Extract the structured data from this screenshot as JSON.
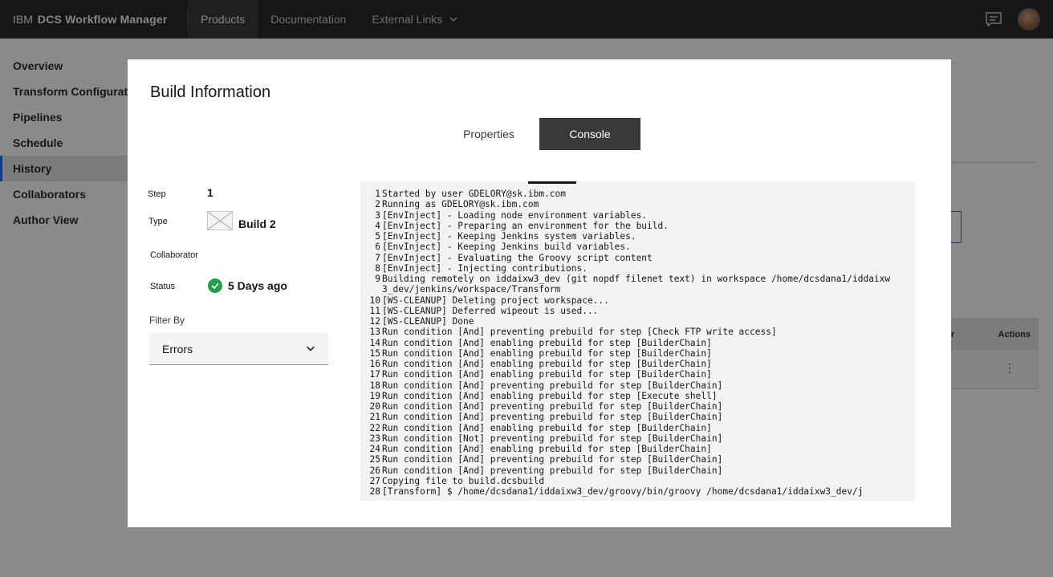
{
  "header": {
    "brand_prefix": "IBM",
    "brand_name": "DCS Workflow Manager",
    "nav": [
      {
        "label": "Products",
        "active": true
      },
      {
        "label": "Documentation",
        "active": false
      },
      {
        "label": "External Links",
        "active": false
      }
    ],
    "icons": [
      "chat-icon",
      "avatar"
    ]
  },
  "sidenav": {
    "items": [
      {
        "label": "Overview",
        "active": false
      },
      {
        "label": "Transform Configuration",
        "active": false
      },
      {
        "label": "Pipelines",
        "active": false
      },
      {
        "label": "Schedule",
        "active": false
      },
      {
        "label": "History",
        "active": true
      },
      {
        "label": "Collaborators",
        "active": false
      },
      {
        "label": "Author View",
        "active": false
      }
    ]
  },
  "background_table": {
    "col_partial": "r",
    "actions_header": "Actions",
    "row_menu_icon": "overflow-menu-icon"
  },
  "modal": {
    "title": "Build Information",
    "tabs": [
      {
        "label": "Properties",
        "selected": false
      },
      {
        "label": "Console",
        "selected": true
      }
    ],
    "details": {
      "step_label": "Step",
      "step_value": "1",
      "type_label": "Type",
      "type_value": "Build 2",
      "collaborator_label": "Collaborator",
      "collaborator_value": "",
      "status_label": "Status",
      "status_value": "5 Days ago",
      "status_icon": "checkmark-filled-icon",
      "status_color": "#24a148"
    },
    "filter": {
      "label": "Filter By",
      "selected": "Errors"
    },
    "console": [
      {
        "n": "1",
        "t": "Started by user GDELORY@sk.ibm.com"
      },
      {
        "n": "2",
        "t": "Running as GDELORY@sk.ibm.com"
      },
      {
        "n": "3",
        "t": "[EnvInject] - Loading node environment variables."
      },
      {
        "n": "4",
        "t": "[EnvInject] - Preparing an environment for the build."
      },
      {
        "n": "5",
        "t": "[EnvInject] - Keeping Jenkins system variables."
      },
      {
        "n": "6",
        "t": "[EnvInject] - Keeping Jenkins build variables."
      },
      {
        "n": "7",
        "t": "[EnvInject] - Evaluating the Groovy script content"
      },
      {
        "n": "8",
        "t": "[EnvInject] - Injecting contributions."
      },
      {
        "n": "9",
        "t": "Building remotely on iddaixw3_dev (git nopdf filenet text) in workspace /home/dcsdana1/iddaixw3_dev/jenkins/workspace/Transform"
      },
      {
        "n": "10",
        "t": "[WS-CLEANUP] Deleting project workspace..."
      },
      {
        "n": "11",
        "t": "[WS-CLEANUP] Deferred wipeout is used..."
      },
      {
        "n": "12",
        "t": "[WS-CLEANUP] Done"
      },
      {
        "n": "13",
        "t": "Run condition [And] preventing prebuild for step [Check FTP write access]"
      },
      {
        "n": "14",
        "t": "Run condition [And] enabling prebuild for step [BuilderChain]"
      },
      {
        "n": "15",
        "t": "Run condition [And] enabling prebuild for step [BuilderChain]"
      },
      {
        "n": "16",
        "t": "Run condition [And] enabling prebuild for step [BuilderChain]"
      },
      {
        "n": "17",
        "t": "Run condition [And] enabling prebuild for step [BuilderChain]"
      },
      {
        "n": "18",
        "t": "Run condition [And] preventing prebuild for step [BuilderChain]"
      },
      {
        "n": "19",
        "t": "Run condition [And] enabling prebuild for step [Execute shell]"
      },
      {
        "n": "20",
        "t": "Run condition [And] preventing prebuild for step [BuilderChain]"
      },
      {
        "n": "21",
        "t": "Run condition [And] preventing prebuild for step [BuilderChain]"
      },
      {
        "n": "22",
        "t": "Run condition [And] enabling prebuild for step [BuilderChain]"
      },
      {
        "n": "23",
        "t": "Run condition [Not] preventing prebuild for step [BuilderChain]"
      },
      {
        "n": "24",
        "t": "Run condition [And] enabling prebuild for step [BuilderChain]"
      },
      {
        "n": "25",
        "t": "Run condition [And] preventing prebuild for step [BuilderChain]"
      },
      {
        "n": "26",
        "t": "Run condition [And] preventing prebuild for step [BuilderChain]"
      },
      {
        "n": "27",
        "t": "Copying file to build.dcsbuild"
      },
      {
        "n": "28",
        "t": "[Transform] $ /home/dcsdana1/iddaixw3_dev/groovy/bin/groovy /home/dcsdana1/iddaixw3_dev/j"
      }
    ]
  }
}
